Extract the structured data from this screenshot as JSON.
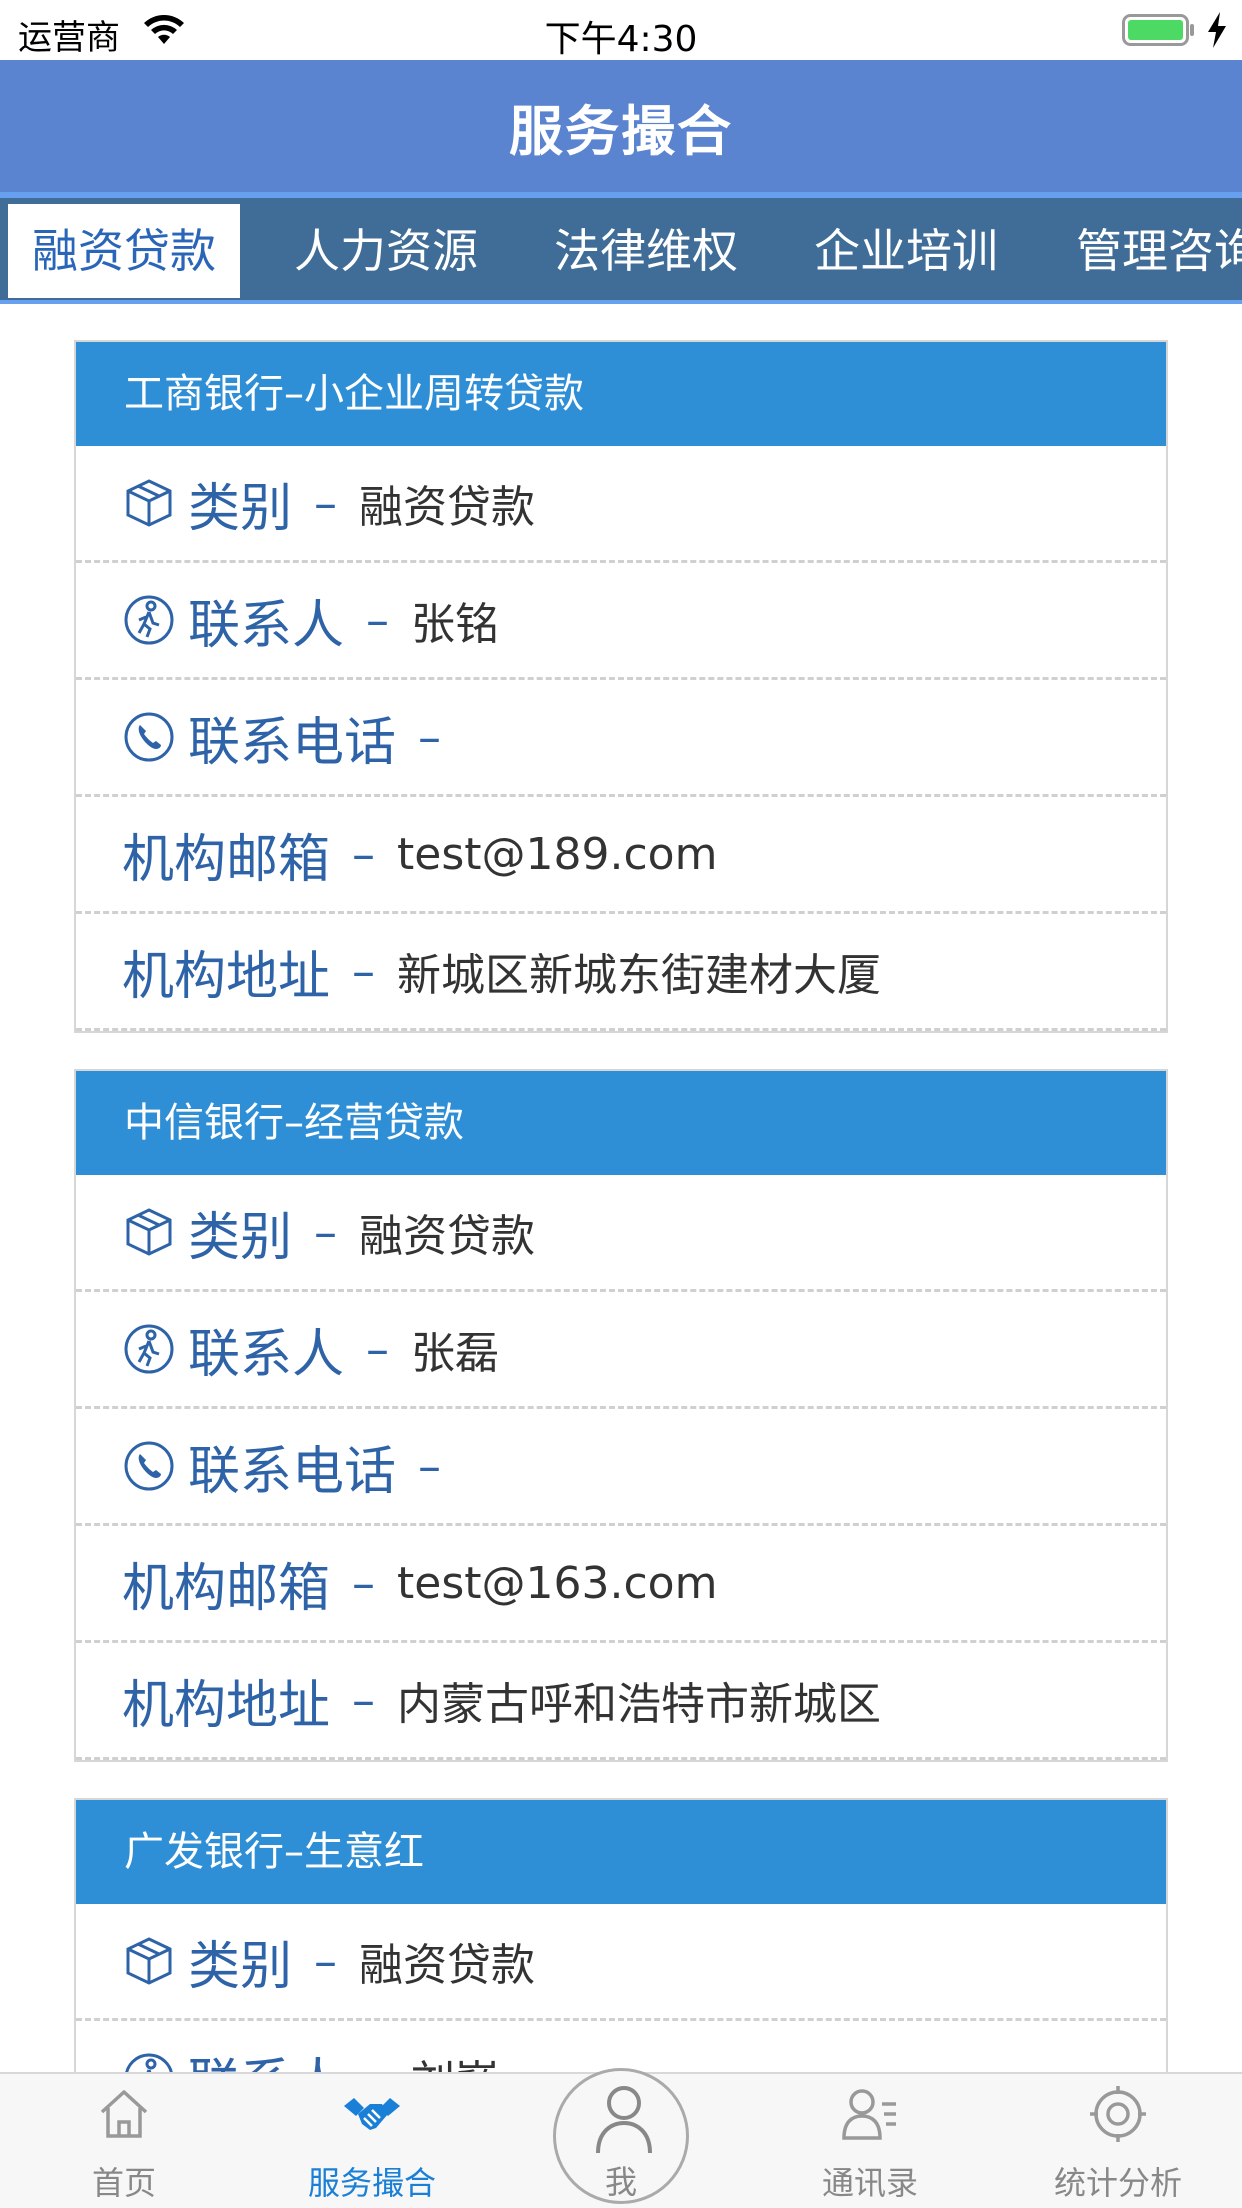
{
  "status_bar": {
    "carrier": "运营商",
    "time": "下午4:30"
  },
  "nav": {
    "title": "服务撮合"
  },
  "tabs": [
    {
      "label": "融资贷款",
      "active": true
    },
    {
      "label": "人力资源"
    },
    {
      "label": "法律维权"
    },
    {
      "label": "企业培训"
    },
    {
      "label": "管理咨询"
    }
  ],
  "cards": [
    {
      "title": "工商银行–小企业周转贷款",
      "category_label": "类别",
      "category": "融资贷款",
      "contact_label": "联系人",
      "contact": "张铭",
      "phone_label": "联系电话",
      "phone": "",
      "email_label": "机构邮箱",
      "email": "test@189.com",
      "address_label": "机构地址",
      "address": "新城区新城东街建材大厦"
    },
    {
      "title": "中信银行–经营贷款",
      "category_label": "类别",
      "category": "融资贷款",
      "contact_label": "联系人",
      "contact": "张磊",
      "phone_label": "联系电话",
      "phone": "",
      "email_label": "机构邮箱",
      "email": "test@163.com",
      "address_label": "机构地址",
      "address": "内蒙古呼和浩特市新城区"
    },
    {
      "title": "广发银行–生意红",
      "category_label": "类别",
      "category": "融资贷款",
      "contact_label": "联系人",
      "contact": "刘巍"
    }
  ],
  "dash": "–",
  "tab_bar": {
    "home": "首页",
    "service": "服务撮合",
    "me": "我",
    "contacts": "通讯录",
    "stats": "统计分析"
  },
  "colors": {
    "nav_bg": "#5a84d0",
    "tab_strip_bg": "#3f6d98",
    "card_header_bg": "#2f8fd6",
    "label_blue": "#2e63a8",
    "active_tab": "#1a7fd6"
  }
}
